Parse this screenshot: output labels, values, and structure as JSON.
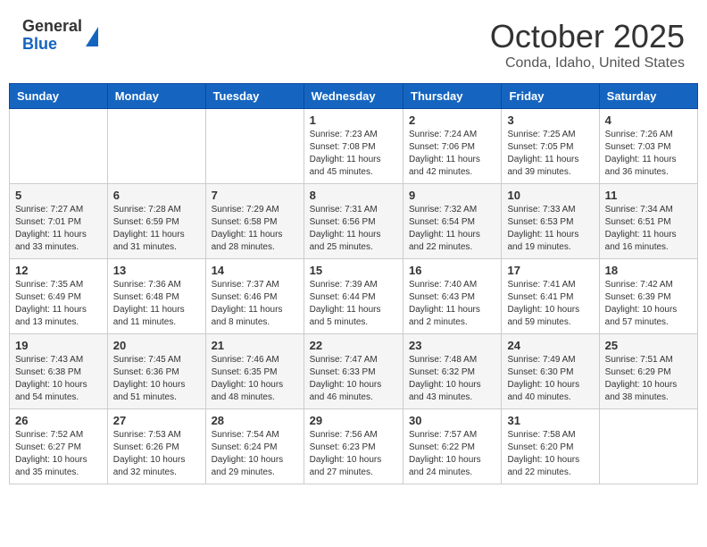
{
  "header": {
    "logo_general": "General",
    "logo_blue": "Blue",
    "month_title": "October 2025",
    "location": "Conda, Idaho, United States"
  },
  "days_of_week": [
    "Sunday",
    "Monday",
    "Tuesday",
    "Wednesday",
    "Thursday",
    "Friday",
    "Saturday"
  ],
  "weeks": [
    [
      {
        "day": "",
        "sunrise": "",
        "sunset": "",
        "daylight": ""
      },
      {
        "day": "",
        "sunrise": "",
        "sunset": "",
        "daylight": ""
      },
      {
        "day": "",
        "sunrise": "",
        "sunset": "",
        "daylight": ""
      },
      {
        "day": "1",
        "sunrise": "Sunrise: 7:23 AM",
        "sunset": "Sunset: 7:08 PM",
        "daylight": "Daylight: 11 hours and 45 minutes."
      },
      {
        "day": "2",
        "sunrise": "Sunrise: 7:24 AM",
        "sunset": "Sunset: 7:06 PM",
        "daylight": "Daylight: 11 hours and 42 minutes."
      },
      {
        "day": "3",
        "sunrise": "Sunrise: 7:25 AM",
        "sunset": "Sunset: 7:05 PM",
        "daylight": "Daylight: 11 hours and 39 minutes."
      },
      {
        "day": "4",
        "sunrise": "Sunrise: 7:26 AM",
        "sunset": "Sunset: 7:03 PM",
        "daylight": "Daylight: 11 hours and 36 minutes."
      }
    ],
    [
      {
        "day": "5",
        "sunrise": "Sunrise: 7:27 AM",
        "sunset": "Sunset: 7:01 PM",
        "daylight": "Daylight: 11 hours and 33 minutes."
      },
      {
        "day": "6",
        "sunrise": "Sunrise: 7:28 AM",
        "sunset": "Sunset: 6:59 PM",
        "daylight": "Daylight: 11 hours and 31 minutes."
      },
      {
        "day": "7",
        "sunrise": "Sunrise: 7:29 AM",
        "sunset": "Sunset: 6:58 PM",
        "daylight": "Daylight: 11 hours and 28 minutes."
      },
      {
        "day": "8",
        "sunrise": "Sunrise: 7:31 AM",
        "sunset": "Sunset: 6:56 PM",
        "daylight": "Daylight: 11 hours and 25 minutes."
      },
      {
        "day": "9",
        "sunrise": "Sunrise: 7:32 AM",
        "sunset": "Sunset: 6:54 PM",
        "daylight": "Daylight: 11 hours and 22 minutes."
      },
      {
        "day": "10",
        "sunrise": "Sunrise: 7:33 AM",
        "sunset": "Sunset: 6:53 PM",
        "daylight": "Daylight: 11 hours and 19 minutes."
      },
      {
        "day": "11",
        "sunrise": "Sunrise: 7:34 AM",
        "sunset": "Sunset: 6:51 PM",
        "daylight": "Daylight: 11 hours and 16 minutes."
      }
    ],
    [
      {
        "day": "12",
        "sunrise": "Sunrise: 7:35 AM",
        "sunset": "Sunset: 6:49 PM",
        "daylight": "Daylight: 11 hours and 13 minutes."
      },
      {
        "day": "13",
        "sunrise": "Sunrise: 7:36 AM",
        "sunset": "Sunset: 6:48 PM",
        "daylight": "Daylight: 11 hours and 11 minutes."
      },
      {
        "day": "14",
        "sunrise": "Sunrise: 7:37 AM",
        "sunset": "Sunset: 6:46 PM",
        "daylight": "Daylight: 11 hours and 8 minutes."
      },
      {
        "day": "15",
        "sunrise": "Sunrise: 7:39 AM",
        "sunset": "Sunset: 6:44 PM",
        "daylight": "Daylight: 11 hours and 5 minutes."
      },
      {
        "day": "16",
        "sunrise": "Sunrise: 7:40 AM",
        "sunset": "Sunset: 6:43 PM",
        "daylight": "Daylight: 11 hours and 2 minutes."
      },
      {
        "day": "17",
        "sunrise": "Sunrise: 7:41 AM",
        "sunset": "Sunset: 6:41 PM",
        "daylight": "Daylight: 10 hours and 59 minutes."
      },
      {
        "day": "18",
        "sunrise": "Sunrise: 7:42 AM",
        "sunset": "Sunset: 6:39 PM",
        "daylight": "Daylight: 10 hours and 57 minutes."
      }
    ],
    [
      {
        "day": "19",
        "sunrise": "Sunrise: 7:43 AM",
        "sunset": "Sunset: 6:38 PM",
        "daylight": "Daylight: 10 hours and 54 minutes."
      },
      {
        "day": "20",
        "sunrise": "Sunrise: 7:45 AM",
        "sunset": "Sunset: 6:36 PM",
        "daylight": "Daylight: 10 hours and 51 minutes."
      },
      {
        "day": "21",
        "sunrise": "Sunrise: 7:46 AM",
        "sunset": "Sunset: 6:35 PM",
        "daylight": "Daylight: 10 hours and 48 minutes."
      },
      {
        "day": "22",
        "sunrise": "Sunrise: 7:47 AM",
        "sunset": "Sunset: 6:33 PM",
        "daylight": "Daylight: 10 hours and 46 minutes."
      },
      {
        "day": "23",
        "sunrise": "Sunrise: 7:48 AM",
        "sunset": "Sunset: 6:32 PM",
        "daylight": "Daylight: 10 hours and 43 minutes."
      },
      {
        "day": "24",
        "sunrise": "Sunrise: 7:49 AM",
        "sunset": "Sunset: 6:30 PM",
        "daylight": "Daylight: 10 hours and 40 minutes."
      },
      {
        "day": "25",
        "sunrise": "Sunrise: 7:51 AM",
        "sunset": "Sunset: 6:29 PM",
        "daylight": "Daylight: 10 hours and 38 minutes."
      }
    ],
    [
      {
        "day": "26",
        "sunrise": "Sunrise: 7:52 AM",
        "sunset": "Sunset: 6:27 PM",
        "daylight": "Daylight: 10 hours and 35 minutes."
      },
      {
        "day": "27",
        "sunrise": "Sunrise: 7:53 AM",
        "sunset": "Sunset: 6:26 PM",
        "daylight": "Daylight: 10 hours and 32 minutes."
      },
      {
        "day": "28",
        "sunrise": "Sunrise: 7:54 AM",
        "sunset": "Sunset: 6:24 PM",
        "daylight": "Daylight: 10 hours and 29 minutes."
      },
      {
        "day": "29",
        "sunrise": "Sunrise: 7:56 AM",
        "sunset": "Sunset: 6:23 PM",
        "daylight": "Daylight: 10 hours and 27 minutes."
      },
      {
        "day": "30",
        "sunrise": "Sunrise: 7:57 AM",
        "sunset": "Sunset: 6:22 PM",
        "daylight": "Daylight: 10 hours and 24 minutes."
      },
      {
        "day": "31",
        "sunrise": "Sunrise: 7:58 AM",
        "sunset": "Sunset: 6:20 PM",
        "daylight": "Daylight: 10 hours and 22 minutes."
      },
      {
        "day": "",
        "sunrise": "",
        "sunset": "",
        "daylight": ""
      }
    ]
  ]
}
